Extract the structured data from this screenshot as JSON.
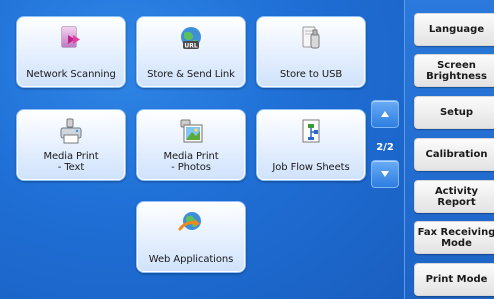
{
  "tiles": [
    {
      "name": "tile-network-scanning",
      "label": "Network Scanning",
      "icon": "network-scan-icon"
    },
    {
      "name": "tile-store-send-link",
      "label": "Store & Send Link",
      "icon": "url-globe-icon"
    },
    {
      "name": "tile-store-to-usb",
      "label": "Store to USB",
      "icon": "usb-icon"
    },
    {
      "name": "tile-media-print-text",
      "label": "Media Print\n- Text",
      "icon": "printer-media-icon"
    },
    {
      "name": "tile-media-print-photos",
      "label": "Media Print\n- Photos",
      "icon": "photo-print-icon"
    },
    {
      "name": "tile-job-flow-sheets",
      "label": "Job Flow Sheets",
      "icon": "job-flow-icon"
    },
    {
      "name": "tile-web-applications",
      "label": "Web Applications",
      "icon": "web-globe-icon"
    }
  ],
  "pager": {
    "indicator": "2/2",
    "up_icon": "arrow-up-icon",
    "down_icon": "arrow-down-icon"
  },
  "side_menu": [
    {
      "name": "side-btn-language",
      "label": "Language"
    },
    {
      "name": "side-btn-screen-brightness",
      "label": "Screen\nBrightness"
    },
    {
      "name": "side-btn-setup",
      "label": "Setup"
    },
    {
      "name": "side-btn-calibration",
      "label": "Calibration"
    },
    {
      "name": "side-btn-activity-report",
      "label": "Activity Report"
    },
    {
      "name": "side-btn-fax-receiving-mode",
      "label": "Fax Receiving\nMode"
    },
    {
      "name": "side-btn-print-mode",
      "label": "Print Mode"
    }
  ],
  "colors": {
    "panel_blue": "#1f6fd6",
    "tile_border": "#8fc0ff",
    "scroll_btn": "#2d7ee0"
  }
}
